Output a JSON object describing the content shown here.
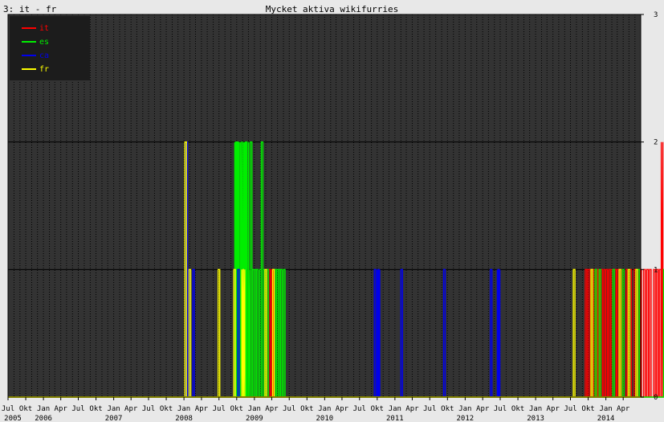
{
  "page_title": "3: it - fr",
  "chart_data": {
    "type": "line",
    "title": "Mycket aktiva wikifurries",
    "xlabel": "",
    "ylabel": "",
    "x_range": [
      "2005-07-01",
      "2014-07-01"
    ],
    "ylim": [
      0,
      3
    ],
    "y_ticks": [
      0,
      1,
      2,
      3
    ],
    "x_tick_labels": [
      "Jul",
      "Okt",
      "Jan",
      "Apr",
      "Jul",
      "Okt",
      "Jan",
      "Apr",
      "Jul",
      "Okt",
      "Jan",
      "Apr",
      "Jul",
      "Okt",
      "Jan",
      "Apr",
      "Jul",
      "Okt",
      "Jan",
      "Apr",
      "Jul",
      "Okt",
      "Jan",
      "Apr",
      "Jul",
      "Okt",
      "Jan",
      "Apr",
      "Jul",
      "Okt",
      "Jan",
      "Apr",
      "Jul",
      "Okt",
      "Jan",
      "Apr"
    ],
    "year_labels": [
      {
        "year": "2005",
        "date": "2005-07-01"
      },
      {
        "year": "2006",
        "date": "2006-01-01"
      },
      {
        "year": "2007",
        "date": "2007-01-01"
      },
      {
        "year": "2008",
        "date": "2008-01-01"
      },
      {
        "year": "2009",
        "date": "2009-01-01"
      },
      {
        "year": "2010",
        "date": "2010-01-01"
      },
      {
        "year": "2011",
        "date": "2011-01-01"
      },
      {
        "year": "2012",
        "date": "2012-01-01"
      },
      {
        "year": "2013",
        "date": "2013-01-01"
      },
      {
        "year": "2014",
        "date": "2014-01-01"
      }
    ],
    "grid": true,
    "legend_position": "top-left",
    "background": "#333333",
    "series": [
      {
        "name": "it",
        "color": "#ff0000",
        "spikes": [
          [
            "2009-03-20",
            1
          ],
          [
            "2009-04-05",
            1
          ],
          [
            "2013-09-20",
            1
          ],
          [
            "2013-10-01",
            1
          ],
          [
            "2013-10-10",
            1
          ],
          [
            "2013-10-20",
            1
          ],
          [
            "2013-11-01",
            1
          ],
          [
            "2013-11-15",
            1
          ],
          [
            "2013-11-25",
            1
          ],
          [
            "2013-12-10",
            1
          ],
          [
            "2013-12-25",
            1
          ],
          [
            "2014-01-05",
            1
          ],
          [
            "2014-01-20",
            1
          ],
          [
            "2014-02-01",
            1
          ],
          [
            "2014-02-20",
            1
          ],
          [
            "2014-03-05",
            1
          ],
          [
            "2014-03-25",
            1
          ],
          [
            "2014-04-20",
            1
          ],
          [
            "2014-05-10",
            1
          ],
          [
            "2014-06-01",
            1
          ],
          [
            "2014-07-01",
            1
          ],
          [
            "2014-07-20",
            1
          ],
          [
            "2014-08-05",
            1
          ],
          [
            "2014-08-20",
            1
          ],
          [
            "2014-09-10",
            1
          ],
          [
            "2014-09-25",
            1
          ],
          [
            "2014-10-10",
            1
          ],
          [
            "2014-10-20",
            2
          ],
          [
            "2014-10-28",
            1
          ]
        ]
      },
      {
        "name": "es",
        "color": "#00ee00",
        "spikes": [
          [
            "2008-09-25",
            2
          ],
          [
            "2008-10-01",
            2
          ],
          [
            "2008-10-05",
            2
          ],
          [
            "2008-10-10",
            2
          ],
          [
            "2008-10-15",
            1
          ],
          [
            "2008-10-25",
            2
          ],
          [
            "2008-11-01",
            2
          ],
          [
            "2008-11-08",
            1
          ],
          [
            "2008-11-15",
            2
          ],
          [
            "2008-11-20",
            2
          ],
          [
            "2008-11-28",
            2
          ],
          [
            "2008-12-05",
            1
          ],
          [
            "2008-12-15",
            2
          ],
          [
            "2008-12-25",
            1
          ],
          [
            "2009-01-05",
            1
          ],
          [
            "2009-01-15",
            1
          ],
          [
            "2009-02-01",
            1
          ],
          [
            "2009-02-10",
            2
          ],
          [
            "2009-02-20",
            1
          ],
          [
            "2009-03-01",
            1
          ],
          [
            "2009-03-10",
            1
          ],
          [
            "2009-04-20",
            1
          ],
          [
            "2009-05-01",
            1
          ],
          [
            "2009-05-10",
            1
          ],
          [
            "2009-05-20",
            1
          ],
          [
            "2009-06-05",
            1
          ],
          [
            "2013-11-10",
            1
          ],
          [
            "2013-12-01",
            1
          ],
          [
            "2014-02-10",
            1
          ],
          [
            "2014-04-01",
            1
          ],
          [
            "2014-06-20",
            1
          ],
          [
            "2014-11-01",
            1
          ]
        ]
      },
      {
        "name": "ca",
        "color": "#0000ee",
        "spikes": [
          [
            "2008-01-15",
            2
          ],
          [
            "2008-01-25",
            1
          ],
          [
            "2008-02-20",
            1
          ],
          [
            "2008-09-20",
            1
          ],
          [
            "2008-10-10",
            1
          ],
          [
            "2010-09-20",
            1
          ],
          [
            "2010-10-05",
            1
          ],
          [
            "2010-10-10",
            1
          ],
          [
            "2011-02-05",
            1
          ],
          [
            "2011-09-15",
            1
          ],
          [
            "2012-05-15",
            1
          ],
          [
            "2012-06-20",
            1
          ],
          [
            "2012-06-25",
            1
          ]
        ]
      },
      {
        "name": "fr",
        "color": "#ffff00",
        "spikes": [
          [
            "2008-01-10",
            2
          ],
          [
            "2008-02-01",
            1
          ],
          [
            "2008-07-01",
            1
          ],
          [
            "2008-09-20",
            1
          ],
          [
            "2008-11-01",
            1
          ],
          [
            "2008-11-08",
            1
          ],
          [
            "2009-03-01",
            1
          ],
          [
            "2009-04-10",
            1
          ],
          [
            "2013-07-20",
            1
          ],
          [
            "2013-10-20",
            1
          ],
          [
            "2014-03-15",
            1
          ],
          [
            "2014-05-01",
            1
          ],
          [
            "2014-06-10",
            1
          ]
        ]
      }
    ]
  }
}
